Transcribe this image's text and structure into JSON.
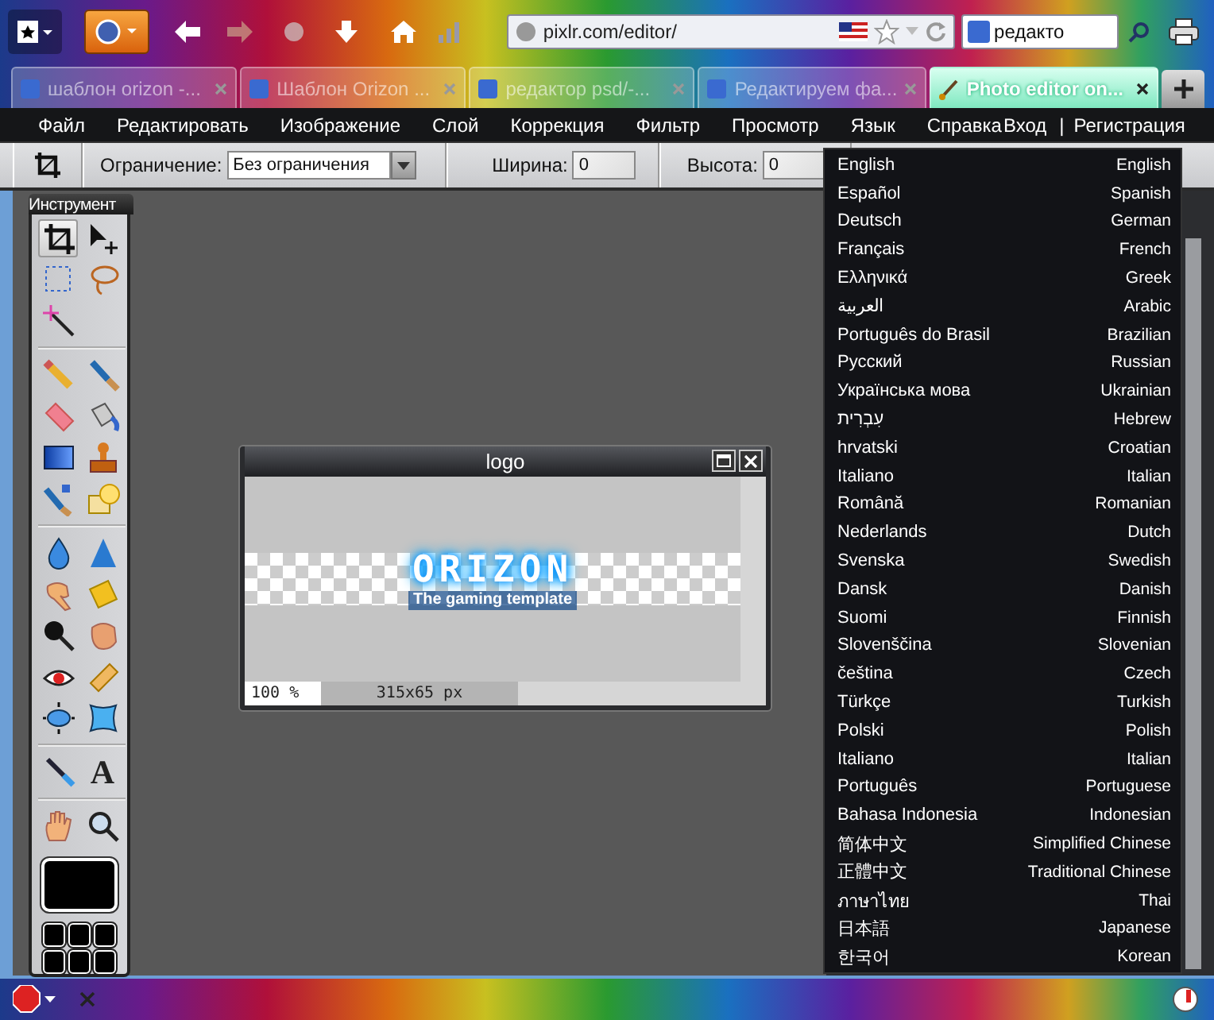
{
  "browser": {
    "address": "pixlr.com/editor/",
    "search_value": "редакто",
    "tabs": [
      {
        "title": "шаблон orizon -...",
        "selected": false
      },
      {
        "title": "Шаблон Orizon ...",
        "selected": false
      },
      {
        "title": "редактор psd/-...",
        "selected": false
      },
      {
        "title": "Редактируем фа...",
        "selected": false
      },
      {
        "title": "Photo editor on...",
        "selected": true
      }
    ]
  },
  "menubar": {
    "items": [
      "Файл",
      "Редактировать",
      "Изображение",
      "Слой",
      "Коррекция",
      "Фильтр",
      "Просмотр",
      "Язык",
      "Справка"
    ],
    "login": "Вход",
    "separator": "|",
    "register": "Регистрация"
  },
  "toolbar": {
    "constraint_label": "Ограничение:",
    "constraint_value": "Без ограничения",
    "width_label": "Ширина:",
    "width_value": "0",
    "height_label": "Высота:",
    "height_value": "0"
  },
  "tools_panel": {
    "title": "Инструмент",
    "type_glyph": "A",
    "tools": [
      {
        "selected": true
      },
      {
        "selected": false
      },
      {
        "selected": false
      },
      {
        "selected": false
      },
      {
        "selected": false
      },
      {
        "selected": false
      },
      {
        "selected": false
      },
      {
        "selected": false
      },
      {
        "selected": false
      },
      {
        "selected": false
      },
      {
        "selected": false
      },
      {
        "selected": false
      },
      {
        "selected": false
      },
      {
        "selected": false
      },
      {
        "selected": false
      },
      {
        "selected": false
      },
      {
        "selected": false
      },
      {
        "selected": false
      },
      {
        "selected": false
      },
      {
        "selected": false
      },
      {
        "selected": false
      },
      {
        "selected": false
      },
      {
        "selected": false
      },
      {
        "selected": false
      },
      {
        "selected": false
      },
      {
        "selected": false
      },
      {
        "selected": false
      }
    ]
  },
  "document": {
    "title": "logo",
    "logo_text": "ORIZON",
    "tagline": "The gaming template",
    "zoom": "100 %",
    "size": "315x65 px"
  },
  "language_menu": {
    "items": [
      {
        "name": "English",
        "english": "English"
      },
      {
        "name": "Español",
        "english": "Spanish"
      },
      {
        "name": "Deutsch",
        "english": "German"
      },
      {
        "name": "Français",
        "english": "French"
      },
      {
        "name": "Ελληνικά",
        "english": "Greek"
      },
      {
        "name": "العربية",
        "english": "Arabic"
      },
      {
        "name": "Português do Brasil",
        "english": "Brazilian"
      },
      {
        "name": "Русский",
        "english": "Russian"
      },
      {
        "name": "Українська мова",
        "english": "Ukrainian"
      },
      {
        "name": "עִבְרִית",
        "english": "Hebrew"
      },
      {
        "name": "hrvatski",
        "english": "Croatian"
      },
      {
        "name": "Italiano",
        "english": "Italian"
      },
      {
        "name": "Română",
        "english": "Romanian"
      },
      {
        "name": "Nederlands",
        "english": "Dutch"
      },
      {
        "name": "Svenska",
        "english": "Swedish"
      },
      {
        "name": "Dansk",
        "english": "Danish"
      },
      {
        "name": "Suomi",
        "english": "Finnish"
      },
      {
        "name": "Slovenščina",
        "english": "Slovenian"
      },
      {
        "name": "čeština",
        "english": "Czech"
      },
      {
        "name": "Türkçe",
        "english": "Turkish"
      },
      {
        "name": "Polski",
        "english": "Polish"
      },
      {
        "name": "Italiano",
        "english": "Italian"
      },
      {
        "name": "Português",
        "english": "Portuguese"
      },
      {
        "name": "Bahasa Indonesia",
        "english": "Indonesian"
      },
      {
        "name": "简体中文",
        "english": "Simplified Chinese"
      },
      {
        "name": "正體中文",
        "english": "Traditional Chinese"
      },
      {
        "name": "ภาษาไทย",
        "english": "Thai"
      },
      {
        "name": "日本語",
        "english": "Japanese"
      },
      {
        "name": "한국어",
        "english": "Korean"
      }
    ]
  }
}
